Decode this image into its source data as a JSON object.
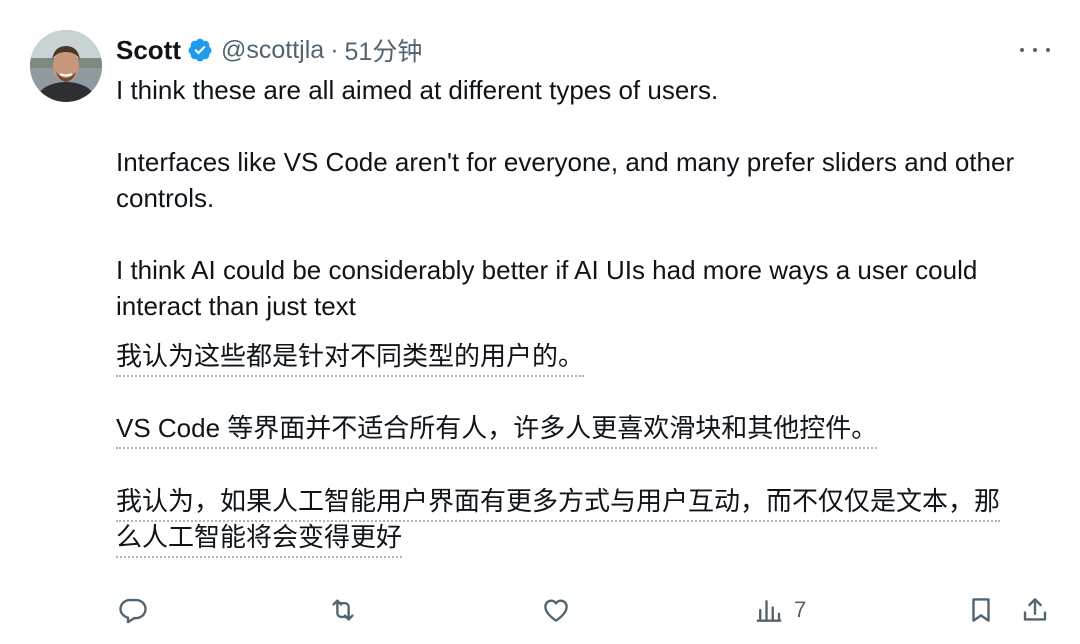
{
  "author": {
    "name": "Scott",
    "handle": "@scottjla",
    "separator": "·",
    "time": "51分钟"
  },
  "tweet": {
    "paragraphs": [
      "I think these are all aimed at different types of users.",
      "Interfaces like VS Code aren't for everyone, and many prefer sliders and other controls.",
      "I think AI could be considerably better if AI UIs had more ways a user could interact than just text"
    ],
    "translation": [
      "我认为这些都是针对不同类型的用户的。",
      "VS Code 等界面并不适合所有人，许多人更喜欢滑块和其他控件。",
      "我认为，如果人工智能用户界面有更多方式与用户互动，而不仅仅是文本，那",
      "么人工智能将会变得更好"
    ]
  },
  "actions": {
    "views_count": "7"
  },
  "colors": {
    "verified": "#1d9bf0",
    "secondary_text": "#536471",
    "primary_text": "#0f1419"
  }
}
